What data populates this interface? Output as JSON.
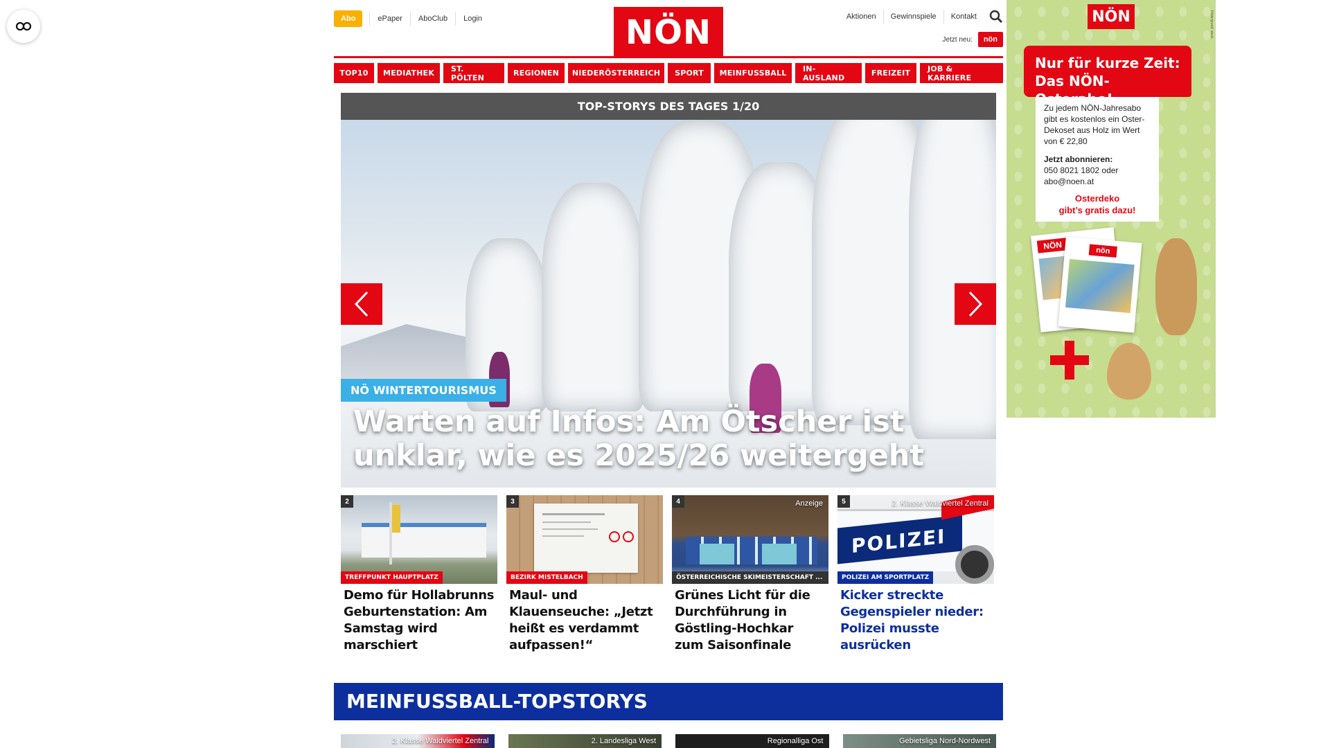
{
  "header": {
    "abo": "Abo",
    "left_links": [
      "ePaper",
      "AboClub",
      "Login"
    ],
    "logo": "NÖN",
    "right_links": [
      "Aktionen",
      "Gewinnspiele",
      "Kontakt"
    ],
    "jetzt_neu": "Jetzt neu:",
    "jetzt_logo": "nön"
  },
  "nav": [
    "TOP10",
    "MEDIATHEK",
    "ST. PÖLTEN",
    "REGIONEN",
    "NIEDERÖSTERREICH",
    "SPORT",
    "MEINFUSSBALL",
    "IN-AUSLAND",
    "FREIZEIT",
    "JOB & KARRIERE"
  ],
  "slider": {
    "heading": "TOP-STORYS DES TAGES 1/20",
    "kicker": "NÖ WINTERTOURISMUS",
    "headline": "Warten auf Infos: Am Ötscher ist unklar, wie es 2025/26 weitergeht"
  },
  "cards": [
    {
      "num": "2",
      "corner": "",
      "tag": "TREFFPUNKT HAUPTPLATZ",
      "tag_color": "#e30613",
      "title": "Demo für Hollabrunns Geburtenstation: Am Samstag wird marschiert",
      "title_color": "#111111"
    },
    {
      "num": "3",
      "corner": "",
      "tag": "BEZIRK MISTELBACH",
      "tag_color": "#e30613",
      "title": "Maul- und Klauenseuche: „Jetzt heißt es verdammt aufpassen!“",
      "title_color": "#111111"
    },
    {
      "num": "4",
      "corner": "Anzeige",
      "tag": "ÖSTERREICHISCHE SKIMEISTERSCHAFT ...",
      "tag_color": "#333333",
      "title": "Grünes Licht für die Durchführung in Göstling-Hochkar zum Saisonfinale",
      "title_color": "#111111"
    },
    {
      "num": "5",
      "corner": "2. Klasse Waldviertel Zentral",
      "tag": "POLIZEI AM SPORTPLATZ",
      "tag_color": "#0d2f9e",
      "title": "Kicker streckte Gegenspieler nieder: Polizei musste ausrücken",
      "title_color": "#0d2f9e"
    }
  ],
  "section": {
    "title": "MEINFUSSBALL-TOPSTORYS",
    "cards": [
      "2. Klasse Waldviertel Zentral",
      "2. Landesliga West",
      "Regionalliga Ost",
      "Gebietsliga Nord-Nordwest"
    ]
  },
  "ad": {
    "logo": "NÖN",
    "banner_line1": "Nur für kurze Zeit:",
    "banner_line2": "Das NÖN-Osterabo!",
    "text": "Zu jedem NÖN-Jahresabo gibt es kostenlos ein Oster-Dekoset aus Holz im Wert von € 22,80",
    "cta_title": "Jetzt abonnieren:",
    "cta_text": "050 8021 1802 oder abo@noen.at",
    "red_line1": "Osterdeko",
    "red_line2": "gibt’s gratis dazu!"
  },
  "colors": {
    "brand_red": "#e30613",
    "abo_yellow": "#f9b000",
    "section_blue": "#0d2f9e",
    "kicker_blue": "#3ab0e6"
  },
  "icons": {
    "accessibility": "glasses-icon",
    "search": "search-icon",
    "prev": "chevron-left-icon",
    "next": "chevron-right-icon"
  }
}
